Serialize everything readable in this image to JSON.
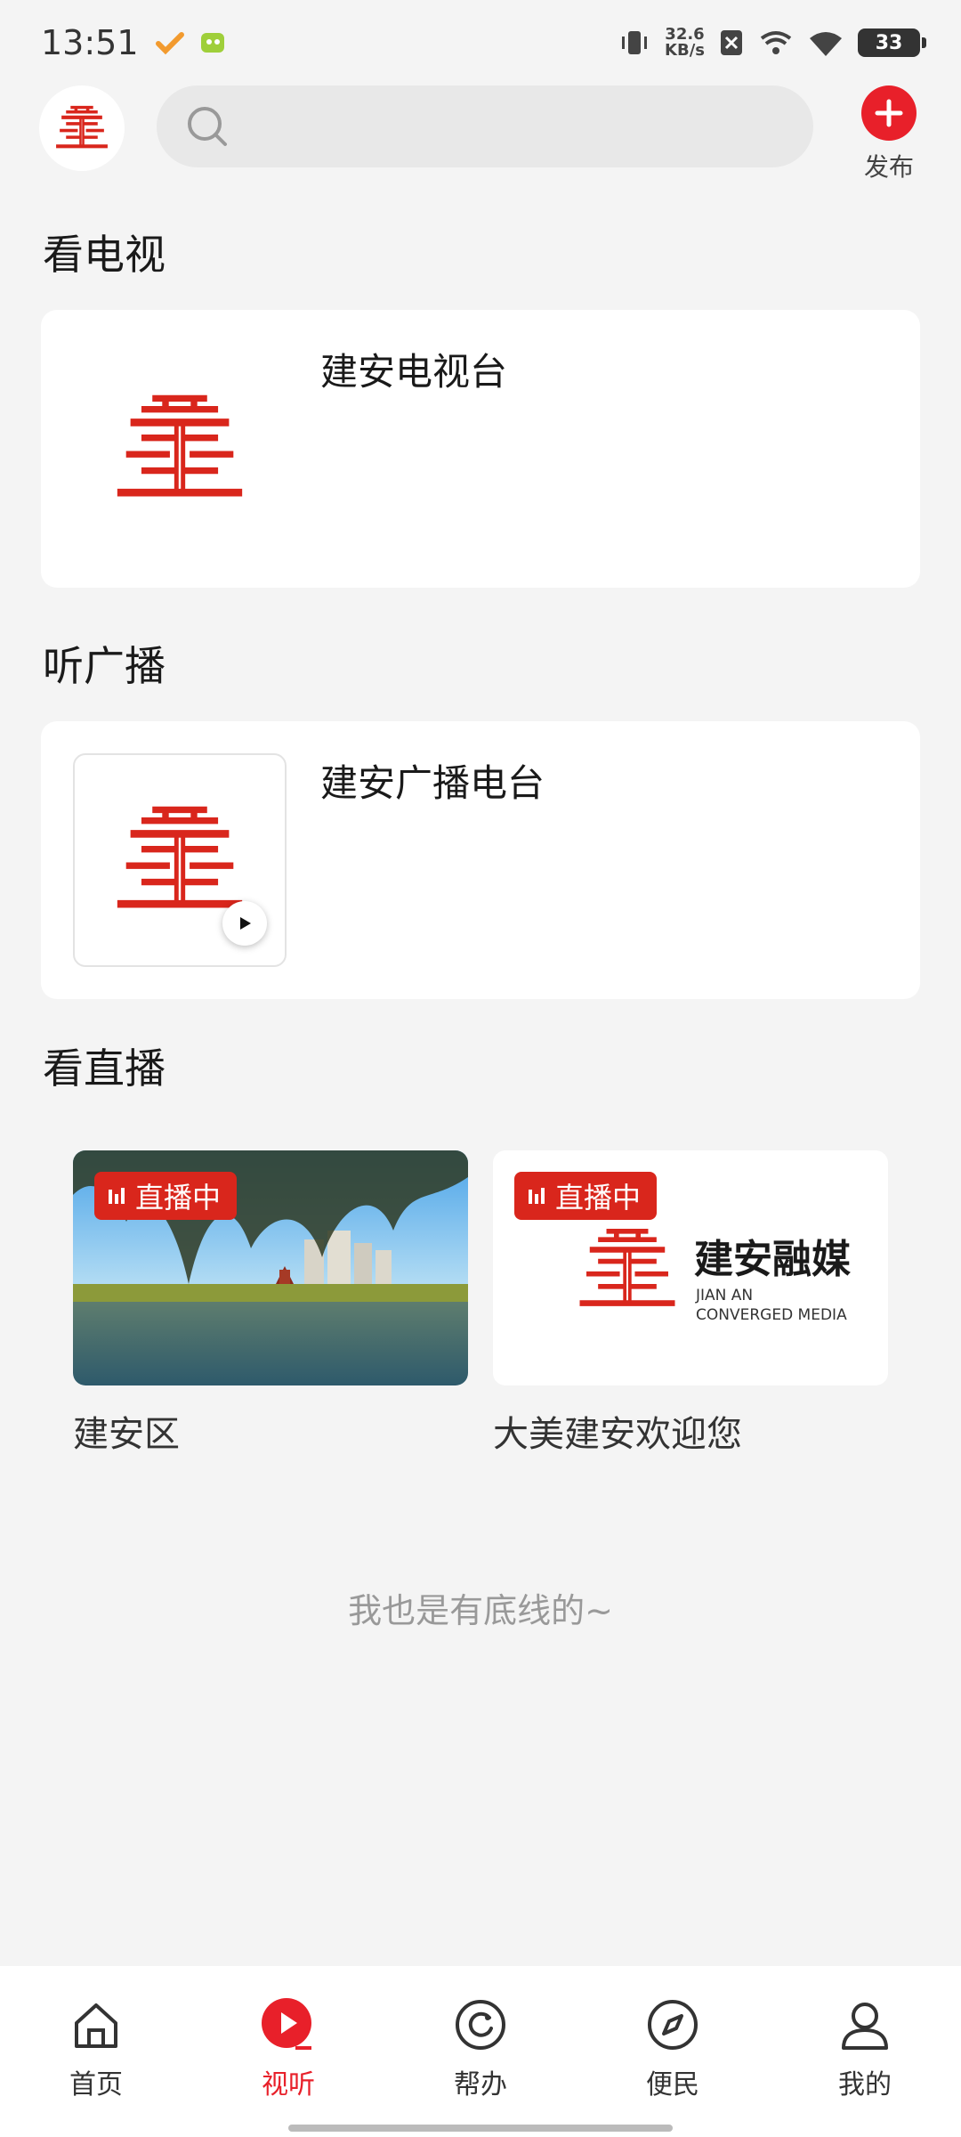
{
  "status_bar": {
    "time": "13:51",
    "net_speed_value": "32.6",
    "net_speed_unit": "KB/s",
    "battery": "33"
  },
  "header": {
    "search_placeholder": "",
    "publish_label": "发布"
  },
  "sections": {
    "tv": {
      "title": "看电视",
      "channel_name": "建安电视台"
    },
    "radio": {
      "title": "听广播",
      "channel_name": "建安广播电台"
    },
    "live": {
      "title": "看直播",
      "items": [
        {
          "badge": "直播中",
          "label": "建安区"
        },
        {
          "badge": "直播中",
          "label": "大美建安欢迎您",
          "logo_text": "建安融媒",
          "logo_sub1": "JIAN AN",
          "logo_sub2": "CONVERGED MEDIA"
        }
      ]
    }
  },
  "footer_note": "我也是有底线的~",
  "bottom_nav": {
    "items": [
      {
        "label": "首页",
        "icon": "home-icon"
      },
      {
        "label": "视听",
        "icon": "play-icon"
      },
      {
        "label": "帮办",
        "icon": "help-icon"
      },
      {
        "label": "便民",
        "icon": "compass-icon"
      },
      {
        "label": "我的",
        "icon": "user-icon"
      }
    ],
    "active_index": 1
  },
  "colors": {
    "brand_red": "#e8202a",
    "live_badge": "#d9261c",
    "background": "#f4f4f4"
  }
}
